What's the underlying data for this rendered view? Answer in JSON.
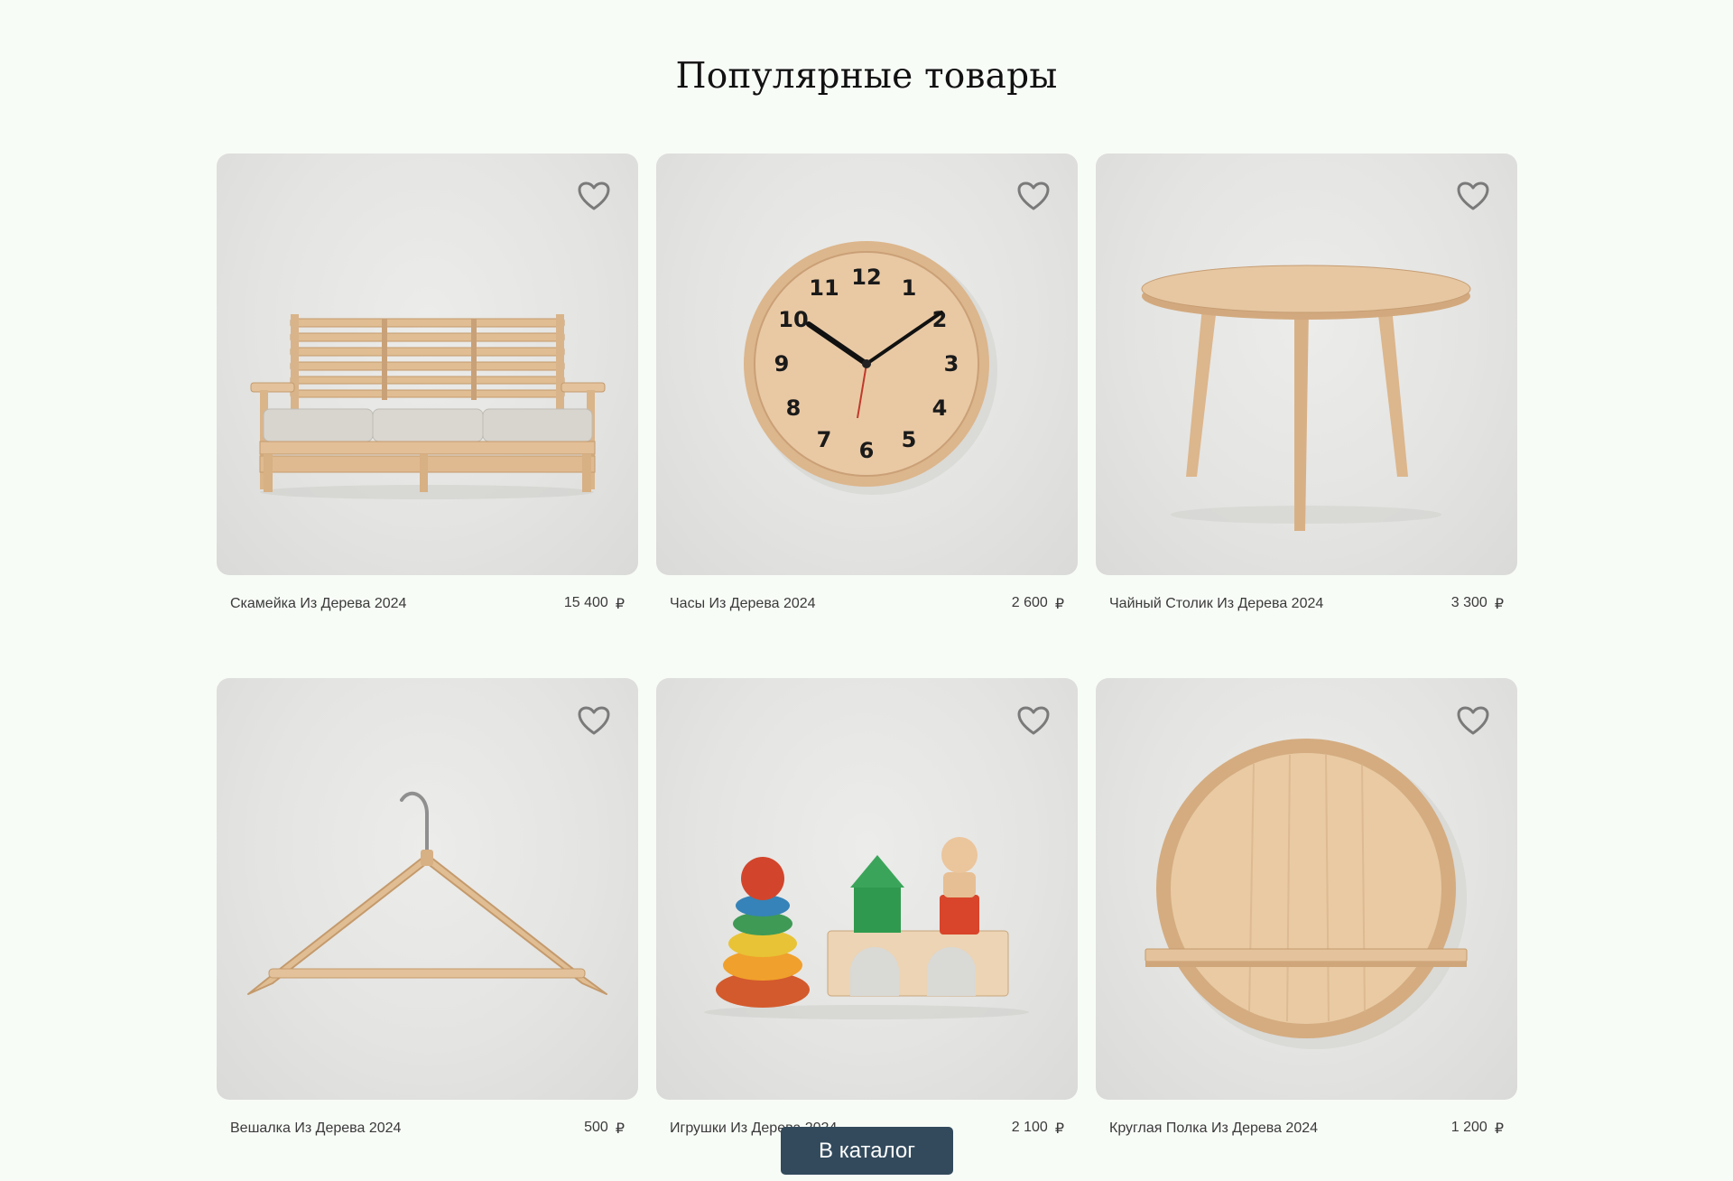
{
  "section": {
    "title": "Популярные товары"
  },
  "currency": "₽",
  "products": [
    {
      "name": "Скамейка Из Дерева 2024",
      "price": "15 400",
      "image": "wooden-bench",
      "favorite_icon": "heart-icon"
    },
    {
      "name": "Часы Из Дерева 2024",
      "price": "2 600",
      "image": "wooden-clock",
      "favorite_icon": "heart-icon"
    },
    {
      "name": "Чайный Столик Из Дерева  2024",
      "price": "3 300",
      "image": "wooden-coffee-table",
      "favorite_icon": "heart-icon"
    },
    {
      "name": "Вешалка Из Дерева 2024",
      "price": "500",
      "image": "wooden-hanger",
      "favorite_icon": "heart-icon"
    },
    {
      "name": "Игрушки Из Дерева 2024",
      "price": "2 100",
      "image": "wooden-toys",
      "favorite_icon": "heart-icon"
    },
    {
      "name": "Круглая Полка Из Дерева 2024",
      "price": "1 200",
      "image": "round-wooden-shelf",
      "favorite_icon": "heart-icon"
    }
  ],
  "catalog_button": {
    "label": "В каталог"
  },
  "colors": {
    "background": "#f8fcf7",
    "button": "#324a5c",
    "wood": "#e2bf97"
  }
}
